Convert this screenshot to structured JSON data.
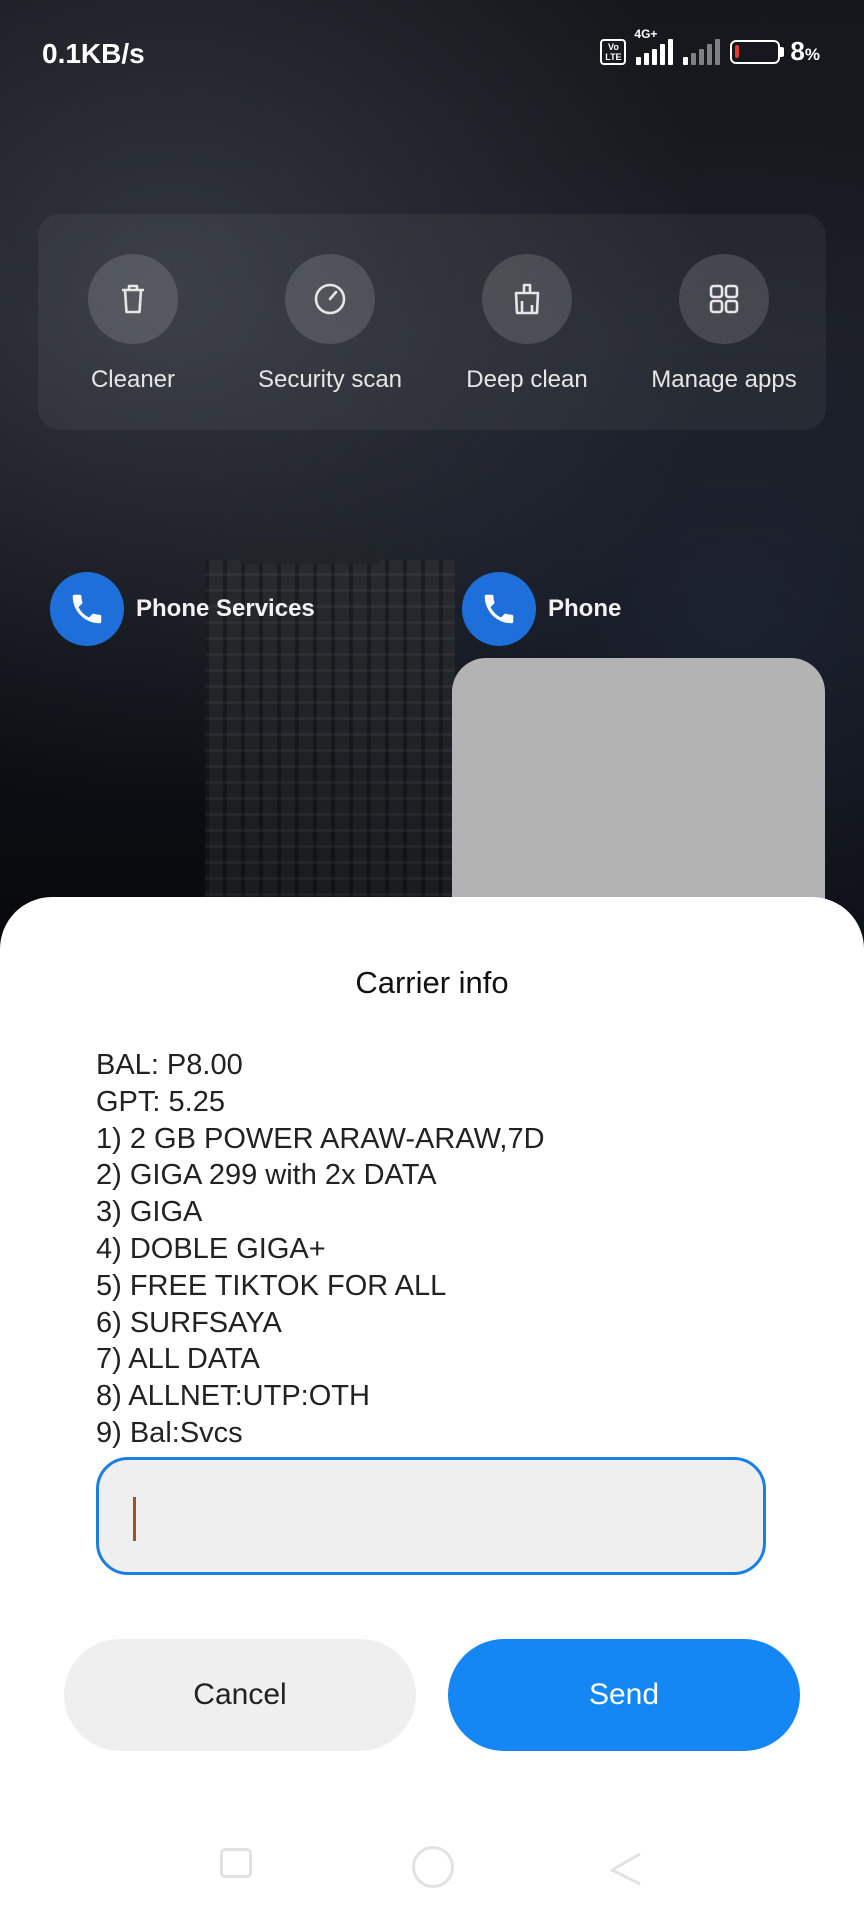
{
  "status_bar": {
    "net_speed": "0.1KB/s",
    "volte_label": "Vo LTE",
    "network_type": "4G+",
    "battery_percent": "8",
    "battery_unit": "%",
    "battery_level": 0.08
  },
  "quick_actions": [
    {
      "label": "Cleaner",
      "icon": "trash-icon"
    },
    {
      "label": "Security scan",
      "icon": "speedometer-icon"
    },
    {
      "label": "Deep clean",
      "icon": "deep-clean-icon"
    },
    {
      "label": "Manage apps",
      "icon": "grid-icon"
    }
  ],
  "shortcuts": [
    {
      "label": "Phone Services",
      "icon": "phone-icon"
    },
    {
      "label": "Phone",
      "icon": "phone-icon"
    }
  ],
  "dialog": {
    "title": "Carrier info",
    "message_lines": [
      "BAL: P8.00",
      "GPT: 5.25",
      "1) 2 GB POWER ARAW-ARAW,7D",
      "2) GIGA 299 with 2x DATA",
      "3) GIGA",
      "4) DOBLE GIGA+",
      "5) FREE TIKTOK FOR ALL",
      "6) SURFSAYA",
      "7) ALL DATA",
      "8) ALLNET:UTP:OTH",
      "9) Bal:Svcs"
    ],
    "input_value": "",
    "cancel_label": "Cancel",
    "send_label": "Send"
  },
  "colors": {
    "accent": "#1487f5",
    "input_border": "#1a7fe0",
    "battery_low": "#e53935",
    "shortcut_icon_bg": "#1e6fd9"
  },
  "nav_bar": {
    "icons": [
      "recents-icon",
      "home-icon",
      "back-icon"
    ]
  }
}
